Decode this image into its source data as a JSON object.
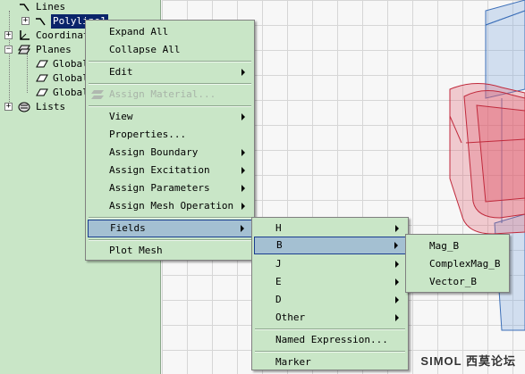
{
  "tree": {
    "nodes": [
      {
        "label": "Lines"
      },
      {
        "label": "Polyline1"
      },
      {
        "label": "Coordinat"
      },
      {
        "label": "Planes"
      },
      {
        "label": "Global"
      },
      {
        "label": "Global"
      },
      {
        "label": "Global"
      },
      {
        "label": "Lists"
      }
    ]
  },
  "context_menu": {
    "items": [
      {
        "label": "Expand All"
      },
      {
        "label": "Collapse All"
      },
      {
        "label": "Edit"
      },
      {
        "label": "Assign Material..."
      },
      {
        "label": "View"
      },
      {
        "label": "Properties..."
      },
      {
        "label": "Assign Boundary"
      },
      {
        "label": "Assign Excitation"
      },
      {
        "label": "Assign Parameters"
      },
      {
        "label": "Assign Mesh Operation"
      },
      {
        "label": "Fields"
      },
      {
        "label": "Plot Mesh"
      }
    ]
  },
  "fields_menu": {
    "items": [
      {
        "label": "H"
      },
      {
        "label": "B"
      },
      {
        "label": "J"
      },
      {
        "label": "E"
      },
      {
        "label": "D"
      },
      {
        "label": "Other"
      },
      {
        "label": "Named Expression..."
      },
      {
        "label": "Marker"
      }
    ]
  },
  "b_menu": {
    "items": [
      {
        "label": "Mag_B"
      },
      {
        "label": "ComplexMag_B"
      },
      {
        "label": "Vector_B"
      }
    ]
  },
  "watermark": {
    "brand": "SIMOL",
    "cn": "西莫论坛"
  },
  "colors": {
    "panel": "#c9e6c7",
    "highlight": "#a4c0d2",
    "grid": "#d6d6d6",
    "red_object": "#e06070",
    "blue_object": "#8ab0e0"
  }
}
